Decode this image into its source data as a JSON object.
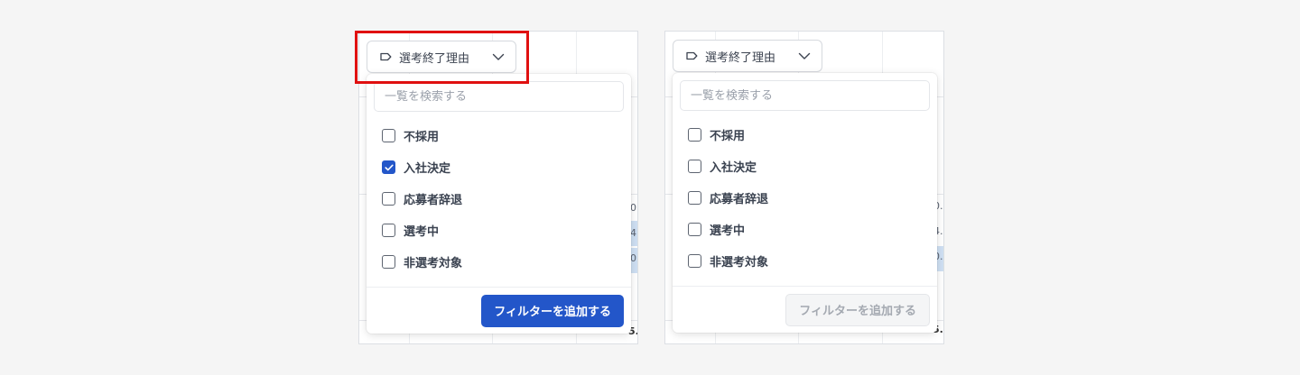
{
  "filter": {
    "trigger_label": "選考終了理由",
    "search_placeholder": "一覧を検索する",
    "add_label": "フィルターを追加する"
  },
  "left_panel": {
    "options": [
      {
        "label": "不採用",
        "checked": false
      },
      {
        "label": "入社決定",
        "checked": true
      },
      {
        "label": "応募者辞退",
        "checked": false
      },
      {
        "label": "選考中",
        "checked": false
      },
      {
        "label": "非選考対象",
        "checked": false
      }
    ],
    "button_state": "enabled"
  },
  "right_panel": {
    "options": [
      {
        "label": "不採用",
        "checked": false
      },
      {
        "label": "入社決定",
        "checked": false
      },
      {
        "label": "応募者辞退",
        "checked": false
      },
      {
        "label": "選考中",
        "checked": false
      },
      {
        "label": "非選考対象",
        "checked": false
      }
    ],
    "button_state": "disabled"
  },
  "table_stubs": {
    "left_row1": "0",
    "left_row2": "4",
    "left_row3": "0",
    "left_bottom": "5.",
    "right_row1": "0.",
    "right_row2": "4.",
    "right_row3": "0.",
    "right_bottom": "5."
  },
  "colors": {
    "primary": "#2356c9",
    "highlight": "#e01010",
    "cell_highlight": "#cfe0f3"
  }
}
